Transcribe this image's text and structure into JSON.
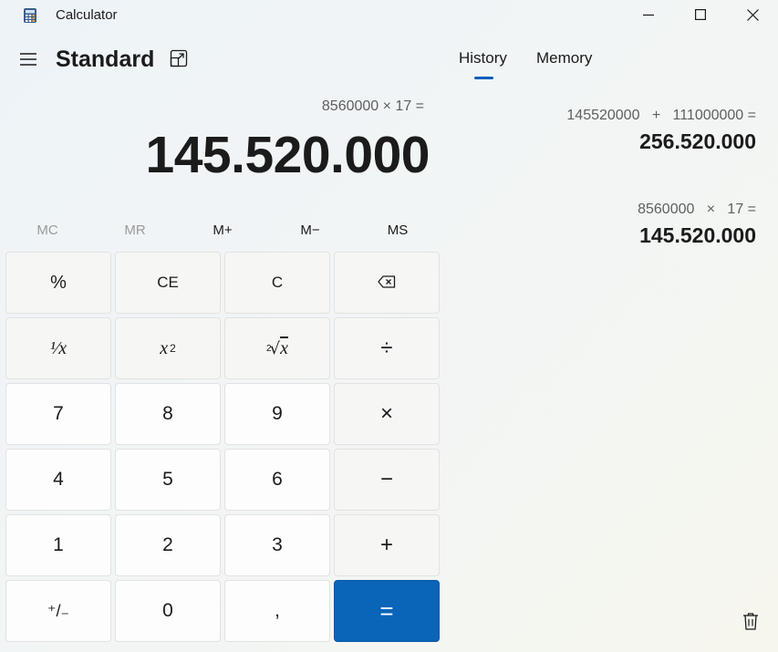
{
  "window": {
    "title": "Calculator",
    "icons": [
      "calculator-app-icon",
      "minimize-icon",
      "maximize-icon",
      "close-icon"
    ]
  },
  "header": {
    "mode_title": "Standard",
    "menu_icon": "hamburger-icon",
    "keep_on_top_icon": "keep-on-top-icon"
  },
  "tabs": [
    {
      "label": "History",
      "selected": true
    },
    {
      "label": "Memory",
      "selected": false
    }
  ],
  "display": {
    "expression": "8560000 × 17 =",
    "result": "145.520.000"
  },
  "memory_buttons": [
    {
      "label": "MC",
      "enabled": false
    },
    {
      "label": "MR",
      "enabled": false
    },
    {
      "label": "M+",
      "enabled": true
    },
    {
      "label": "M−",
      "enabled": true
    },
    {
      "label": "MS",
      "enabled": true
    }
  ],
  "keys": {
    "percent": "%",
    "clear_entry": "CE",
    "clear": "C",
    "backspace_icon": "backspace-icon",
    "reciprocal": "¹⁄x",
    "square_base": "x",
    "square_exp": "2",
    "sqrt_index": "2",
    "sqrt_symbol": "√",
    "sqrt_var": "x",
    "divide": "÷",
    "seven": "7",
    "eight": "8",
    "nine": "9",
    "multiply": "×",
    "four": "4",
    "five": "5",
    "six": "6",
    "subtract": "−",
    "one": "1",
    "two": "2",
    "three": "3",
    "add": "+",
    "negate": "⁺/₋",
    "zero": "0",
    "decimal": ",",
    "equals": "="
  },
  "history": [
    {
      "expression": "145520000   +   111000000 =",
      "result": "256.520.000"
    },
    {
      "expression": "8560000   ×   17 =",
      "result": "145.520.000"
    }
  ],
  "history_clear_icon": "trash-icon",
  "colors": {
    "accent": "#0a64b8",
    "tab_indicator": "#005fb8"
  }
}
